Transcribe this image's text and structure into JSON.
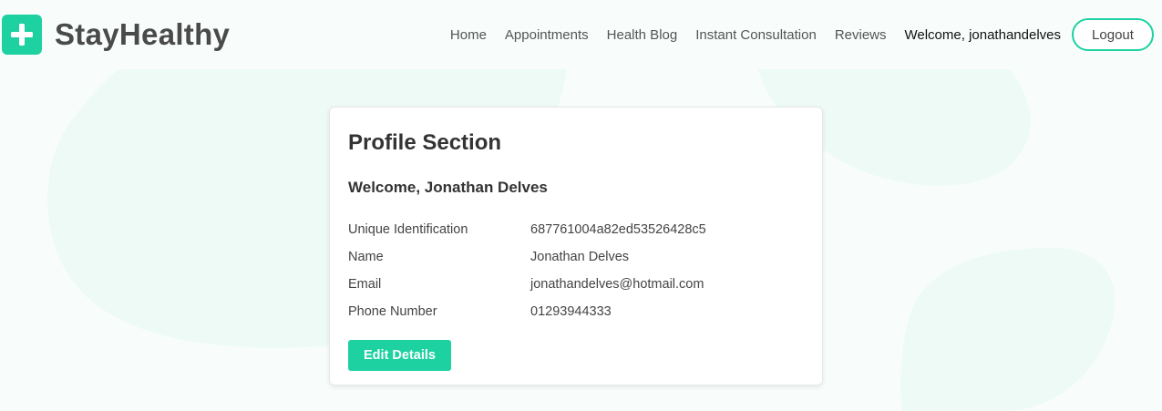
{
  "brand": {
    "name": "StayHealthy",
    "icon": "plus-icon",
    "accent": "#1dd1a1"
  },
  "nav": {
    "links": [
      "Home",
      "Appointments",
      "Health Blog",
      "Instant Consultation",
      "Reviews"
    ],
    "welcome": "Welcome, jonathandelves",
    "logout_label": "Logout"
  },
  "profile": {
    "title": "Profile Section",
    "welcome": "Welcome, Jonathan Delves",
    "fields": [
      {
        "label": "Unique Identification",
        "value": "687761004a82ed53526428c5"
      },
      {
        "label": "Name",
        "value": "Jonathan Delves"
      },
      {
        "label": "Email",
        "value": "jonathandelves@hotmail.com"
      },
      {
        "label": "Phone Number",
        "value": "01293944333"
      }
    ],
    "edit_label": "Edit Details"
  }
}
